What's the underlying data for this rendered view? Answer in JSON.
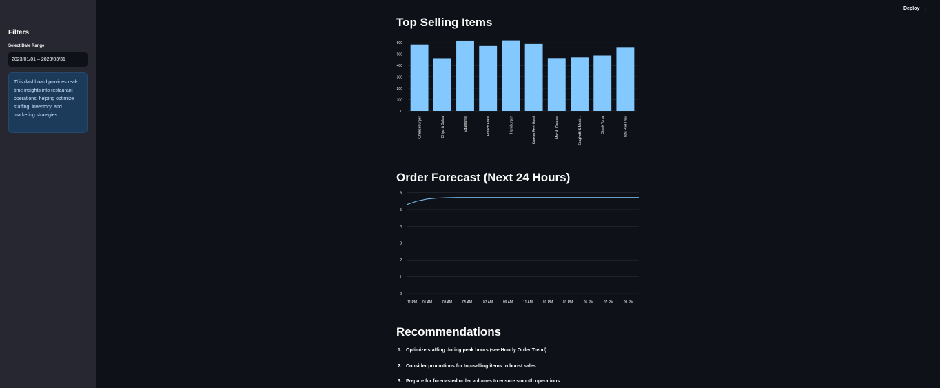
{
  "sidebar": {
    "title": "Filters",
    "date_label": "Select Date Range",
    "date_value": "2023/01/01 – 2023/03/31",
    "info_text": "This dashboard provides real-time insights into restaurant operations, helping optimize staffing, inventory, and marketing strategies."
  },
  "header": {
    "deploy_label": "Deploy",
    "menu_icon": "vertical-dots-icon"
  },
  "sections": {
    "top_selling_title": "Top Selling Items",
    "forecast_title": "Order Forecast (Next 24 Hours)",
    "recommendations_title": "Recommendations"
  },
  "chart_data": [
    {
      "type": "bar",
      "title": "Top Selling Items",
      "categories": [
        "Cheeseburger",
        "Chips & Salsa",
        "Edamame",
        "French Fries",
        "Hamburger",
        "Korean Beef Bowl",
        "Mac & Cheese",
        "Spaghetti & Meat...",
        "Steak Torta",
        "Tofu Pad Thai"
      ],
      "values": [
        585,
        465,
        620,
        572,
        622,
        590,
        466,
        472,
        489,
        563
      ],
      "ylim": [
        0,
        650
      ],
      "yticks": [
        0,
        100,
        200,
        300,
        400,
        500,
        600
      ],
      "color": "#83c9ff",
      "grid": true
    },
    {
      "type": "line",
      "title": "Order Forecast (Next 24 Hours)",
      "x_ticks": [
        "11 PM",
        "01 AM",
        "03 AM",
        "05 AM",
        "07 AM",
        "09 AM",
        "11 AM",
        "01 PM",
        "03 PM",
        "05 PM",
        "07 PM",
        "09 PM"
      ],
      "y": [
        5.3,
        5.5,
        5.62,
        5.67,
        5.69,
        5.7,
        5.7,
        5.7,
        5.7,
        5.7,
        5.7,
        5.7,
        5.7,
        5.7,
        5.7,
        5.7,
        5.7,
        5.7,
        5.7,
        5.7,
        5.7,
        5.7,
        5.7,
        5.7
      ],
      "ylim": [
        0,
        6.1
      ],
      "yticks": [
        0,
        1,
        2,
        3,
        4,
        5,
        6
      ],
      "color": "#83c9ff",
      "grid": true
    }
  ],
  "recommendations": [
    {
      "num": "1.",
      "text": "Optimize staffing during peak hours (see Hourly Order Trend)"
    },
    {
      "num": "2.",
      "text": "Consider promotions for top-selling items to boost sales"
    },
    {
      "num": "3.",
      "text": "Prepare for forecasted order volumes to ensure smooth operations"
    }
  ]
}
